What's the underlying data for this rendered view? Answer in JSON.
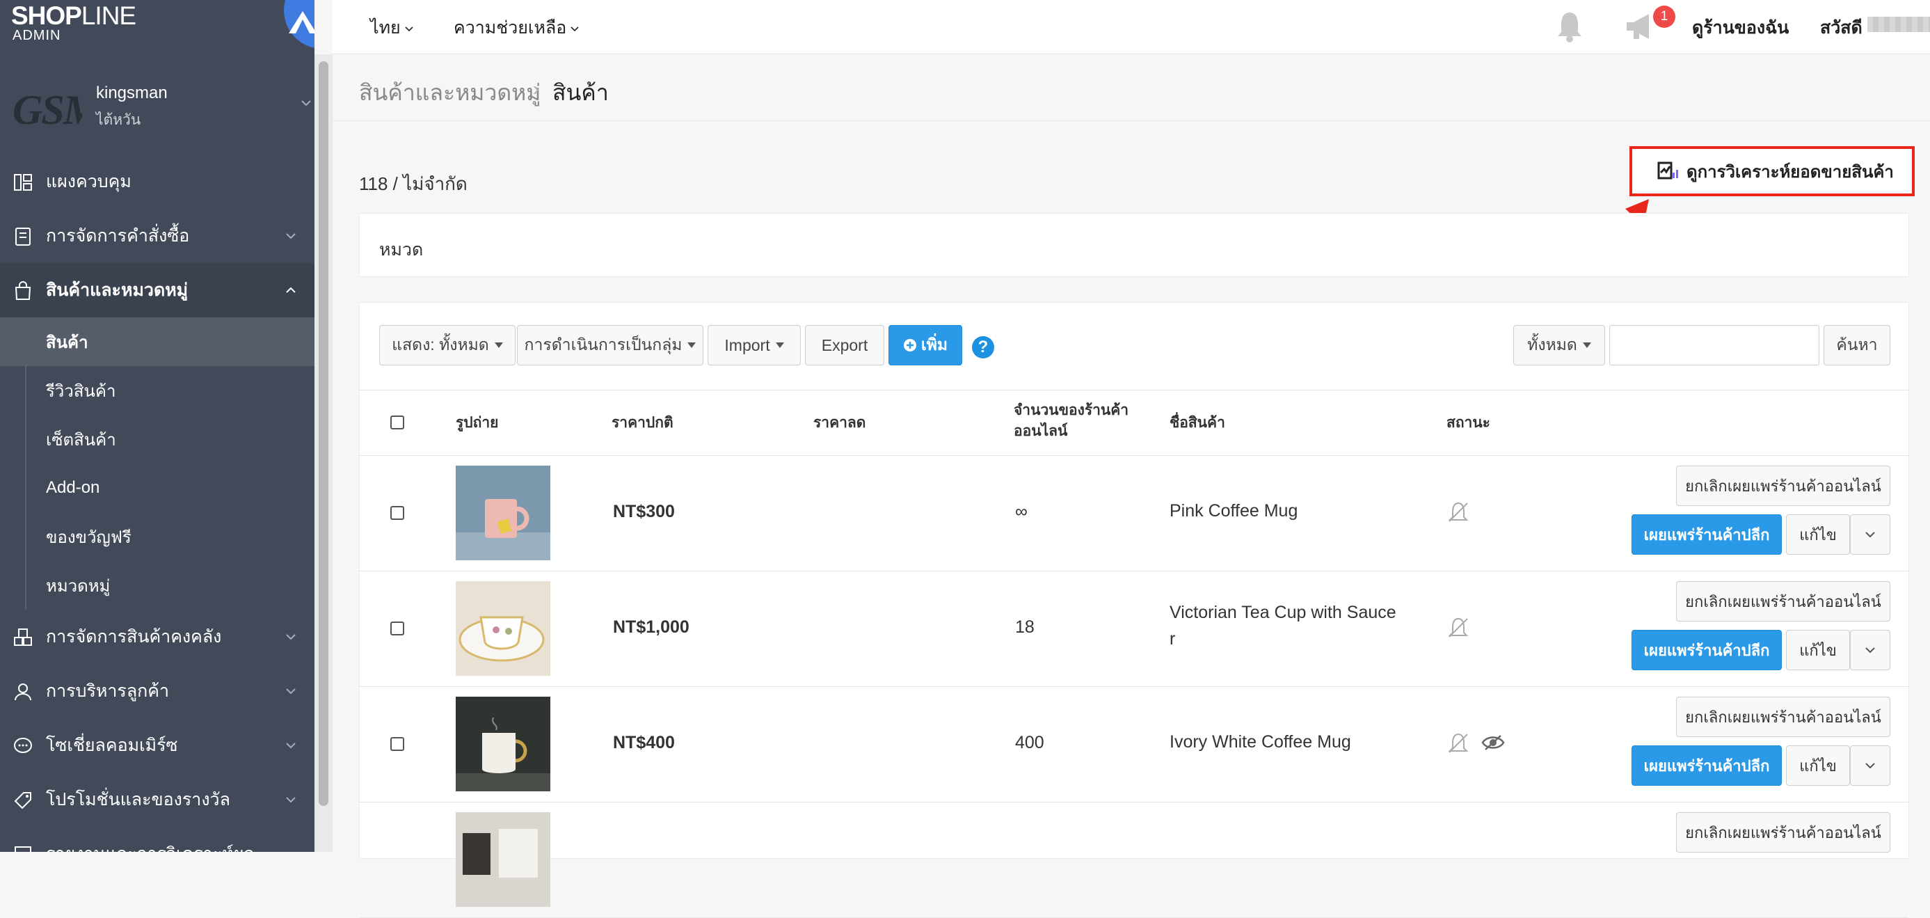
{
  "brand": {
    "logo_bold": "SHOP",
    "logo_light": "LINE",
    "logo_sub": "ADMIN"
  },
  "store": {
    "avatar_text": "GSM",
    "name": "kingsman",
    "region": "ไต้หวัน"
  },
  "sidebar": {
    "items": [
      {
        "label": "แผงควบคุม",
        "icon": "dashboard-icon"
      },
      {
        "label": "การจัดการคำสั่งซื้อ",
        "icon": "receipt-icon"
      },
      {
        "label": "สินค้าและหมวดหมู่",
        "icon": "shopping-bag-icon"
      },
      {
        "label": "การจัดการสินค้าคงคลัง",
        "icon": "inventory-icon"
      },
      {
        "label": "การบริหารลูกค้า",
        "icon": "user-icon"
      },
      {
        "label": "โซเชี่ยลคอมเมิร์ซ",
        "icon": "chat-bubble-icon"
      },
      {
        "label": "โปรโมชั่นและของรางวัล",
        "icon": "tag-icon"
      },
      {
        "label": "รายงานและการวิเคราะห์ผล",
        "icon": "report-icon"
      }
    ],
    "sub_items": [
      "สินค้า",
      "รีวิวสินค้า",
      "เซ็ตสินค้า",
      "Add-on",
      "ของขวัญฟรี",
      "หมวดหมู่"
    ]
  },
  "topbar": {
    "language": "ไทย",
    "help": "ความช่วยเหลือ",
    "notification_count": "1",
    "view_store": "ดูร้านของฉัน",
    "greeting": "สวัสดี"
  },
  "breadcrumb": {
    "parent": "สินค้าและหมวดหมู่",
    "current": "สินค้า"
  },
  "summary": {
    "count": "118 / ไม่จำกัด"
  },
  "analysis_button": "ดูการวิเคราะห์ยอดขายสินค้า",
  "category_label": "หมวด",
  "toolbar": {
    "show": "แสดง: ทั้งหมด",
    "bulk": "การดำเนินการเป็นกลุ่ม",
    "import": "Import",
    "export": "Export",
    "add": "เพิ่ม",
    "filter": "ทั้งหมด",
    "search": "ค้นหา"
  },
  "table": {
    "headers": {
      "photo": "รูปถ่าย",
      "price": "ราคาปกติ",
      "sale": "ราคาลด",
      "stock_1": "จำนวนของร้านค้า",
      "stock_2": "ออนไลน์",
      "name": "ชื่อสินค้า",
      "status": "สถานะ"
    },
    "rows": [
      {
        "price": "NT$300",
        "stock": "∞",
        "name_1": "Pink Coffee Mug",
        "name_2": ""
      },
      {
        "price": "NT$1,000",
        "stock": "18",
        "name_1": "Victorian Tea Cup with Sauce",
        "name_2": "r"
      },
      {
        "price": "NT$400",
        "stock": "400",
        "name_1": "Ivory White Coffee Mug",
        "name_2": ""
      },
      {
        "price": "",
        "stock": "",
        "name_1": "",
        "name_2": ""
      }
    ],
    "actions": {
      "unpublish_online": "ยกเลิกเผยแพร่ร้านค้าออนไลน์",
      "publish_retail": "เผยแพร่ร้านค้าปลีก",
      "edit": "แก้ไข"
    }
  },
  "colors": {
    "sidebar": "#424a59",
    "primary": "#2a99e8",
    "highlight": "#e8261c"
  }
}
